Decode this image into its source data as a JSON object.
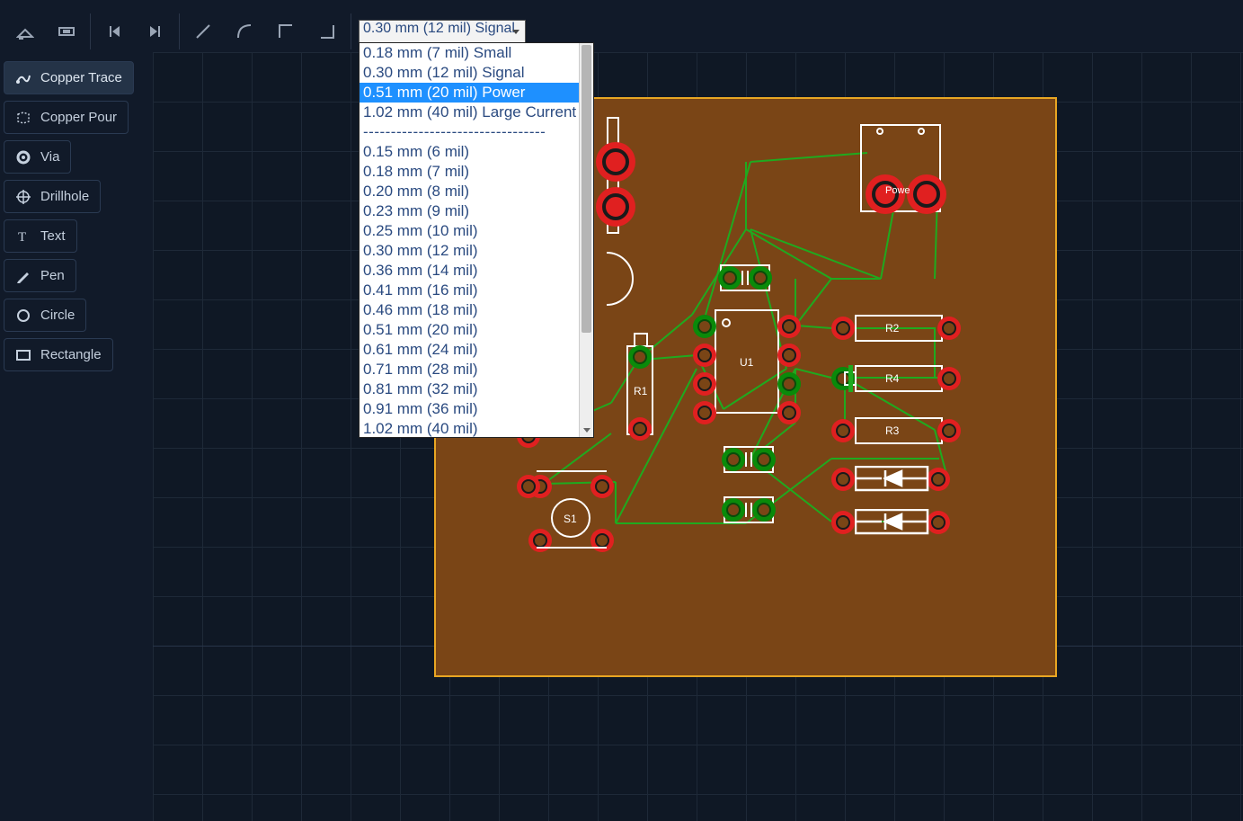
{
  "toolbar": {
    "width_selected": "0.30 mm (12 mil) Signal"
  },
  "dropdown": {
    "items": [
      {
        "label": "0.18 mm (7 mil)   Small",
        "v": "small"
      },
      {
        "label": "0.30 mm (12 mil) Signal",
        "v": "signal"
      },
      {
        "label": "0.51 mm (20 mil) Power",
        "v": "power",
        "selected": true
      },
      {
        "label": "1.02 mm (40 mil) Large Current",
        "v": "large"
      }
    ],
    "sep": "---------------------------------",
    "extra": [
      "0.15 mm (6 mil)",
      "0.18 mm (7 mil)",
      "0.20 mm (8 mil)",
      "0.23 mm (9 mil)",
      "0.25 mm (10 mil)",
      "0.30 mm (12 mil)",
      "0.36 mm (14 mil)",
      "0.41 mm (16 mil)",
      "0.46 mm (18 mil)",
      "0.51 mm (20 mil)",
      "0.61 mm (24 mil)",
      "0.71 mm (28 mil)",
      "0.81 mm (32 mil)",
      "0.91 mm (36 mil)",
      "1.02 mm (40 mil)"
    ]
  },
  "sidebar": [
    {
      "label": "Copper Trace",
      "active": true,
      "icon": "trace"
    },
    {
      "label": "Copper Pour",
      "icon": "pour"
    },
    {
      "label": "Via",
      "icon": "via"
    },
    {
      "label": "Drillhole",
      "icon": "drill"
    },
    {
      "label": "Text",
      "icon": "text"
    },
    {
      "label": "Pen",
      "icon": "pen"
    },
    {
      "label": "Circle",
      "icon": "circle"
    },
    {
      "label": "Rectangle",
      "icon": "rect"
    }
  ],
  "components": {
    "U1": "U1",
    "R1": "R1",
    "R2": "R2",
    "R3": "R3",
    "R4": "R4",
    "S1": "S1",
    "Power": "Powe"
  }
}
